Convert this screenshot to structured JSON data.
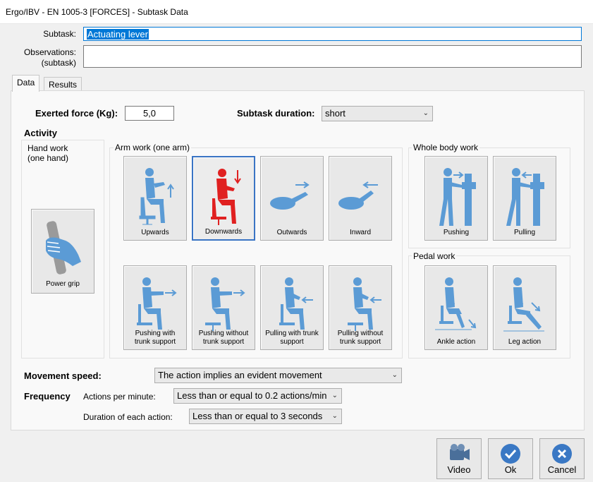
{
  "window": {
    "title": "Ergo/IBV - EN 1005-3 [FORCES] - Subtask Data"
  },
  "subtask": {
    "label": "Subtask:",
    "value": "Actuating lever"
  },
  "observations": {
    "label_line1": "Observations:",
    "label_line2": "(subtask)",
    "value": ""
  },
  "tabs": [
    {
      "label": "Data"
    },
    {
      "label": "Results"
    }
  ],
  "exerted_force": {
    "label": "Exerted force (Kg):",
    "value": "5,0"
  },
  "subtask_duration": {
    "label": "Subtask duration:",
    "value": "short"
  },
  "activity": {
    "title": "Activity",
    "hand_work": {
      "title_line1": "Hand work",
      "title_line2": "(one hand)",
      "tile": "Power grip"
    },
    "arm_work": {
      "title": "Arm work (one arm)",
      "row1": [
        "Upwards",
        "Downwards",
        "Outwards",
        "Inward"
      ],
      "row2": [
        {
          "l1": "Pushing with",
          "l2": "trunk support"
        },
        {
          "l1": "Pushing without",
          "l2": "trunk support"
        },
        {
          "l1": "Pulling with trunk",
          "l2": "support"
        },
        {
          "l1": "Pulling without",
          "l2": "trunk support"
        }
      ],
      "selected": "Downwards"
    },
    "whole_body": {
      "title": "Whole body work",
      "tiles": [
        "Pushing",
        "Pulling"
      ]
    },
    "pedal_work": {
      "title": "Pedal work",
      "tiles": [
        "Ankle action",
        "Leg action"
      ]
    }
  },
  "movement_speed": {
    "label": "Movement speed:",
    "value": "The action implies an evident movement"
  },
  "frequency": {
    "label": "Frequency",
    "actions_label": "Actions per minute:",
    "actions_value": "Less than or equal to 0.2 actions/min",
    "duration_label": "Duration of each action:",
    "duration_value": "Less than or equal to 3 seconds"
  },
  "buttons": {
    "video": "Video",
    "ok": "Ok",
    "cancel": "Cancel"
  },
  "colors": {
    "icon_blue": "#5b9bd5",
    "selected_red": "#e02020",
    "accent": "#0078d7",
    "ok_blue": "#3a78c4"
  }
}
